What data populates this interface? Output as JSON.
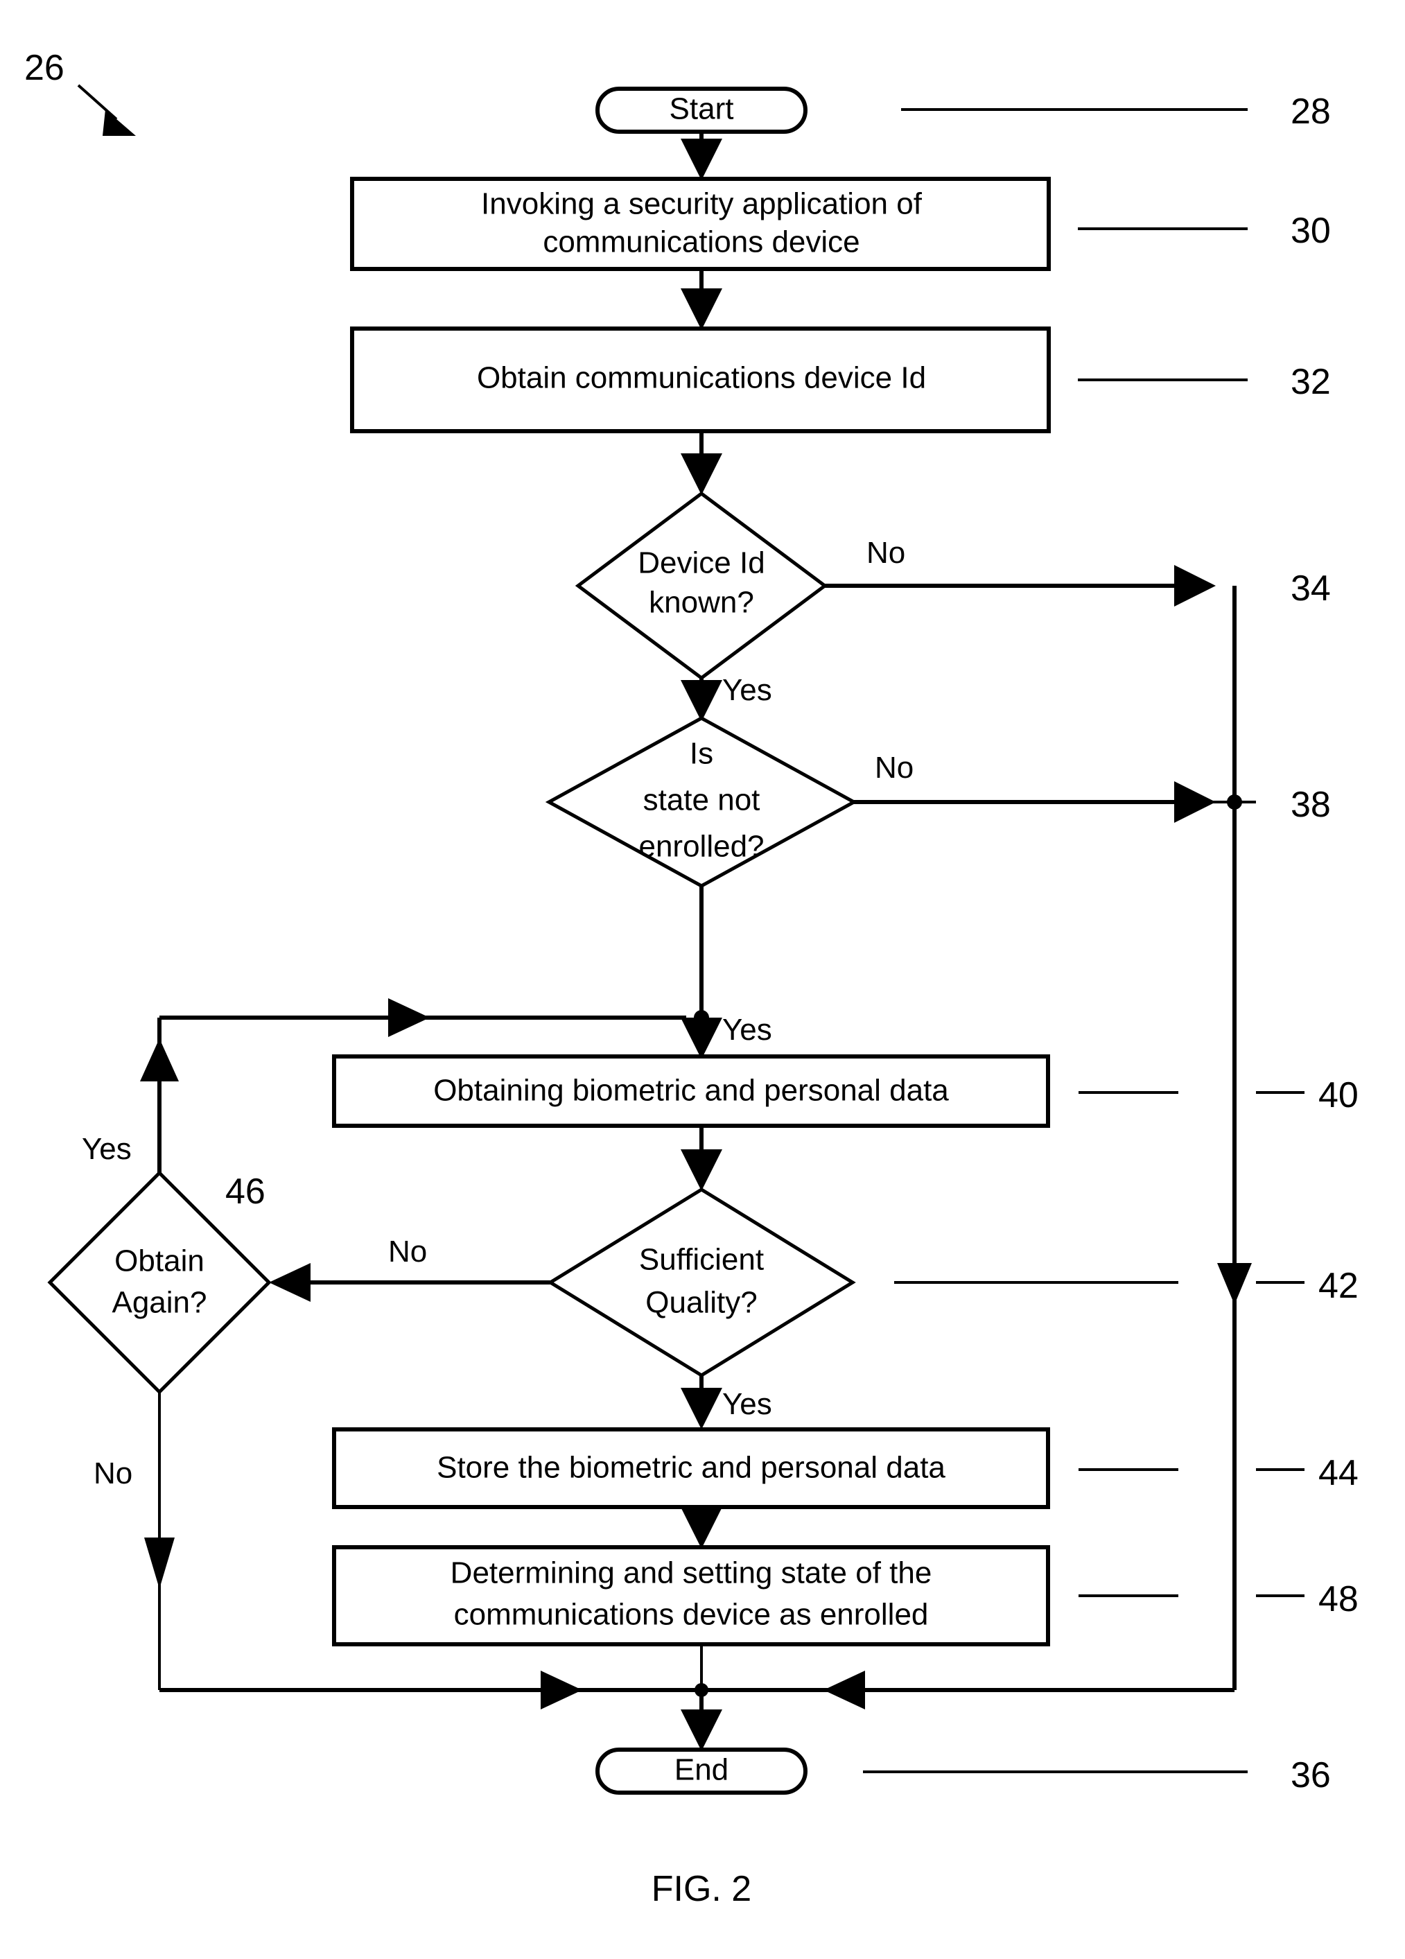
{
  "figure": {
    "caption": "FIG. 2",
    "diagram_ref": "26"
  },
  "nodes": {
    "start": {
      "label": "Start",
      "ref": "28"
    },
    "invoke": {
      "line1": "Invoking a security application of",
      "line2": "communications device",
      "ref": "30"
    },
    "obtain_id": {
      "label": "Obtain communications device Id",
      "ref": "32"
    },
    "device_known": {
      "line1": "Device Id",
      "line2": "known?",
      "ref": "34"
    },
    "state_enrolled": {
      "line1": "Is",
      "line2": "state not",
      "line3": "enrolled?",
      "ref": "38"
    },
    "obtaining_data": {
      "label": "Obtaining biometric and personal data",
      "ref": "40"
    },
    "sufficient_quality": {
      "line1": "Sufficient",
      "line2": "Quality?",
      "ref": "42"
    },
    "obtain_again": {
      "line1": "Obtain",
      "line2": "Again?",
      "ref": "46"
    },
    "store_data": {
      "label": "Store the biometric and personal data",
      "ref": "44"
    },
    "determine_state": {
      "line1": "Determining and setting state of the",
      "line2": "communications device as enrolled",
      "ref": "48"
    },
    "end": {
      "label": "End",
      "ref": "36"
    }
  },
  "edge_labels": {
    "device_known_no": "No",
    "device_known_yes": "Yes",
    "state_enrolled_no": "No",
    "state_enrolled_yes": "Yes",
    "quality_no": "No",
    "quality_yes": "Yes",
    "obtain_again_yes": "Yes",
    "obtain_again_no": "No"
  },
  "colors": {
    "stroke": "#000000",
    "fill": "#ffffff",
    "background": "#ffffff"
  }
}
